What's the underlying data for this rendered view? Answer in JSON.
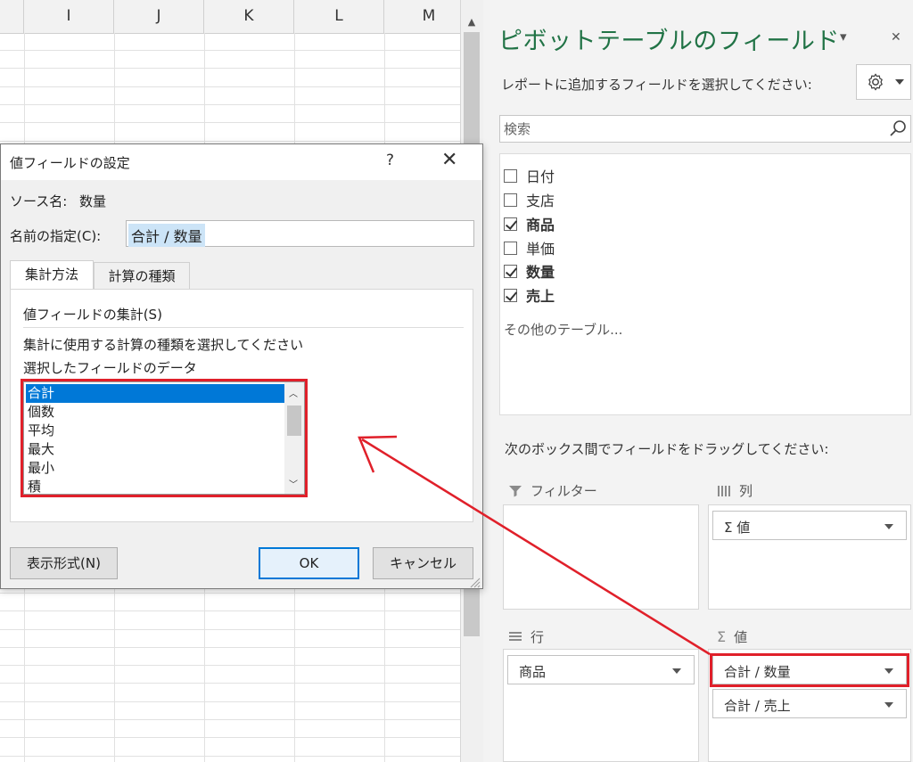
{
  "sheet": {
    "columns": [
      "I",
      "J",
      "K",
      "L",
      "M"
    ]
  },
  "pane": {
    "title": "ピボットテーブルのフィールド",
    "dropdown_glyph": "▾",
    "close_glyph": "✕",
    "subtitle": "レポートに追加するフィールドを選択してください:",
    "search_placeholder": "検索",
    "fields": [
      {
        "label": "日付",
        "checked": false
      },
      {
        "label": "支店",
        "checked": false
      },
      {
        "label": "商品",
        "checked": true
      },
      {
        "label": "単価",
        "checked": false
      },
      {
        "label": "数量",
        "checked": true
      },
      {
        "label": "売上",
        "checked": true
      }
    ],
    "other_tables": "その他のテーブル...",
    "drag_hint": "次のボックス間でフィールドをドラッグしてください:",
    "areas": {
      "filter": {
        "title": "フィルター"
      },
      "columns": {
        "title": "列",
        "chip": "Σ 値"
      },
      "rows": {
        "title": "行",
        "chip": "商品"
      },
      "values": {
        "title": "値",
        "chips": [
          "合計 / 数量",
          "合計 / 売上"
        ]
      }
    }
  },
  "dialog": {
    "title": "値フィールドの設定",
    "help": "?",
    "close": "✕",
    "source_label": "ソース名:",
    "source_value": "数量",
    "name_label": "名前の指定(C):",
    "name_value": "合計 / 数量",
    "tabs": [
      "集計方法",
      "計算の種類"
    ],
    "section_title": "値フィールドの集計(S)",
    "desc1": "集計に使用する計算の種類を選択してください",
    "desc2": "選択したフィールドのデータ",
    "functions": [
      "合計",
      "個数",
      "平均",
      "最大",
      "最小",
      "積"
    ],
    "selected_function": "合計",
    "number_format_button": "表示形式(N)",
    "ok_button": "OK",
    "cancel_button": "キャンセル"
  },
  "colors": {
    "excel_green": "#217346",
    "annotation_red": "#e0202a",
    "selection_blue": "#0078d7"
  }
}
